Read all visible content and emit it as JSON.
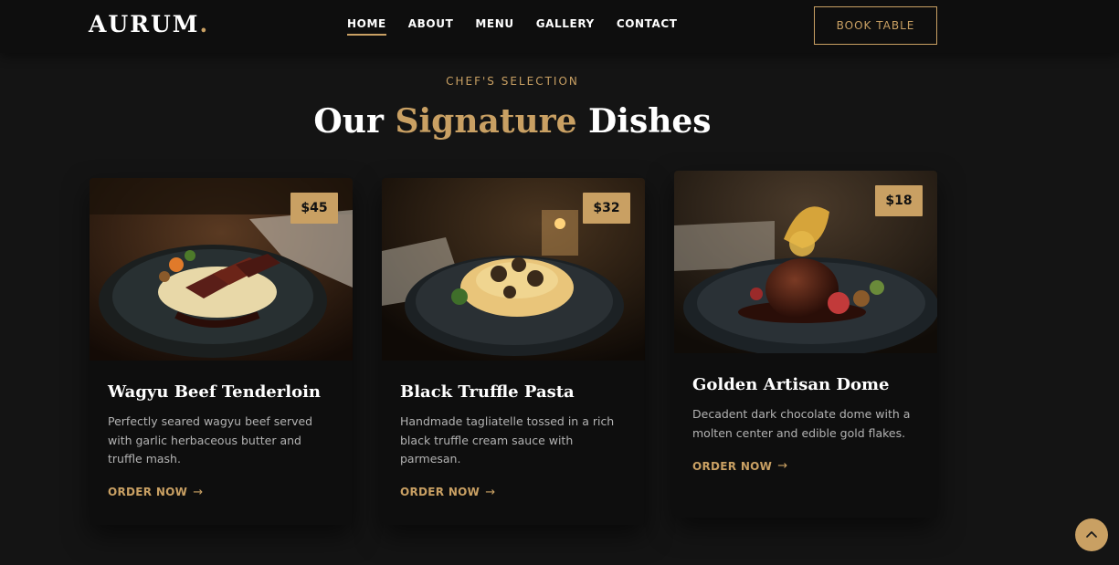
{
  "brand": {
    "name": "AURUM",
    "dot": "."
  },
  "nav": {
    "items": [
      "HOME",
      "ABOUT",
      "MENU",
      "GALLERY",
      "CONTACT"
    ],
    "active": "HOME",
    "book_label": "BOOK TABLE"
  },
  "section": {
    "eyebrow": "CHEF'S SELECTION",
    "title_before": "Our",
    "title_accent": "Signature",
    "title_after": "Dishes"
  },
  "dishes": [
    {
      "name": "Wagyu Beef Tenderloin",
      "price": "$45",
      "description": "Perfectly seared wagyu beef served with garlic herbaceous butter and truffle mash.",
      "cta": "ORDER NOW",
      "image_icon": "steak-plate-photo"
    },
    {
      "name": "Black Truffle Pasta",
      "price": "$32",
      "description": "Handmade tagliatelle tossed in a rich black truffle cream sauce with parmesan.",
      "cta": "ORDER NOW",
      "image_icon": "pasta-plate-photo"
    },
    {
      "name": "Golden Artisan Dome",
      "price": "$18",
      "description": "Decadent dark chocolate dome with a molten center and edible gold flakes.",
      "cta": "ORDER NOW",
      "image_icon": "dessert-dome-photo"
    }
  ],
  "colors": {
    "accent": "#c9a063",
    "background": "#141414",
    "card": "#0e0e0e"
  }
}
